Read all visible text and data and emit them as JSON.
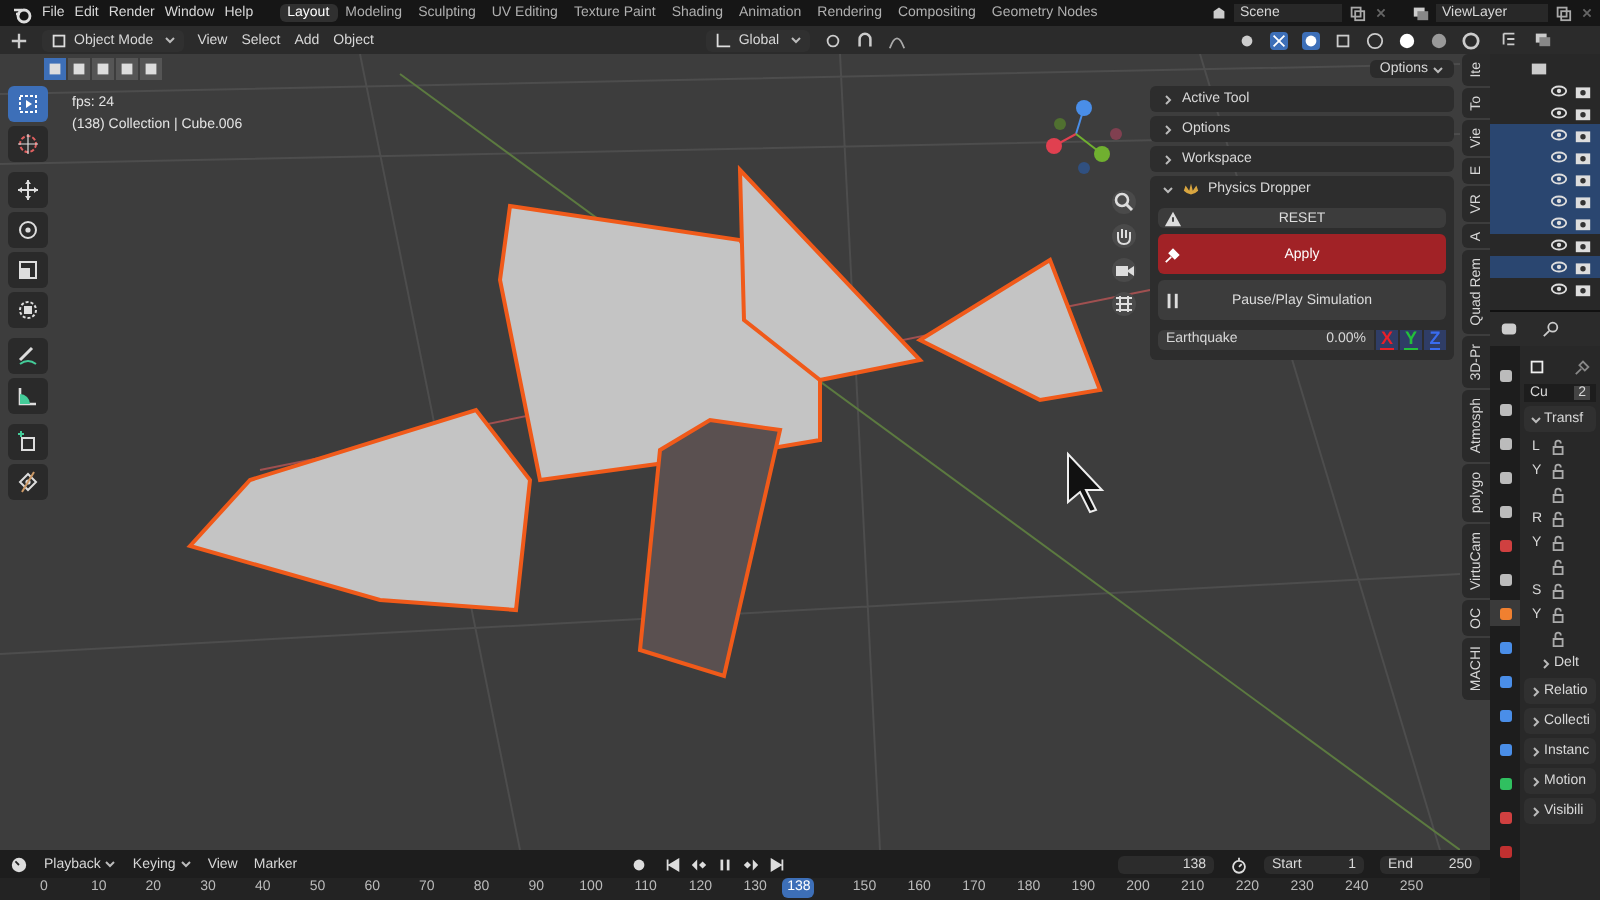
{
  "app_menu": [
    "File",
    "Edit",
    "Render",
    "Window",
    "Help"
  ],
  "workspaces": [
    {
      "label": "Layout",
      "selected": true
    },
    {
      "label": "Modeling",
      "selected": false
    },
    {
      "label": "Sculpting",
      "selected": false
    },
    {
      "label": "UV Editing",
      "selected": false
    },
    {
      "label": "Texture Paint",
      "selected": false
    },
    {
      "label": "Shading",
      "selected": false
    },
    {
      "label": "Animation",
      "selected": false
    },
    {
      "label": "Rendering",
      "selected": false
    },
    {
      "label": "Compositing",
      "selected": false
    },
    {
      "label": "Geometry Nodes",
      "selected": false
    }
  ],
  "scene": "Scene",
  "view_layer": "ViewLayer",
  "viewport_header": {
    "mode": "Object Mode",
    "menus": [
      "View",
      "Select",
      "Add",
      "Object"
    ],
    "orientation": "Global",
    "options": "Options"
  },
  "toolbar": [
    {
      "selected": true
    },
    {
      "selected": false
    },
    {
      "selected": false
    },
    {
      "selected": false
    },
    {
      "selected": false
    },
    {
      "selected": false
    },
    {
      "selected": false
    },
    {
      "selected": false
    },
    {
      "selected": false
    },
    {
      "selected": false
    }
  ],
  "overlay_text": [
    "fps: 24",
    "(138) Collection | Cube.006"
  ],
  "n_panel": {
    "sections": [
      {
        "label": "Active Tool",
        "expanded": false
      },
      {
        "label": "Options",
        "expanded": false
      },
      {
        "label": "Workspace",
        "expanded": false
      },
      {
        "label": "Physics Dropper",
        "expanded": true
      }
    ],
    "reset": "RESET",
    "apply": "Apply",
    "pause": "Pause/Play Simulation",
    "earthquake": {
      "label": "Earthquake",
      "value": "0.00%",
      "level": 0
    },
    "axes": [
      {
        "label": "X",
        "color": "#e8202a"
      },
      {
        "label": "Y",
        "color": "#22c03a"
      },
      {
        "label": "Z",
        "color": "#3a6cf0"
      }
    ]
  },
  "sidebar_tabs": [
    "Ite",
    "To",
    "Vie",
    "E",
    "VR",
    "A",
    "Quad Rem",
    "3D-Pr",
    "Atmosph",
    "polygo",
    "VirtuCam",
    "OC",
    "MACHI"
  ],
  "outliner": [
    {
      "selected": false
    },
    {
      "selected": false
    },
    {
      "selected": true
    },
    {
      "selected": true
    },
    {
      "selected": true
    },
    {
      "selected": true
    },
    {
      "selected": true
    },
    {
      "selected": false
    },
    {
      "selected": true
    },
    {
      "selected": false
    }
  ],
  "properties": {
    "object_name": "Cu",
    "users": "2",
    "tabs": [
      {
        "selected": false
      },
      {
        "selected": false
      },
      {
        "selected": false
      },
      {
        "selected": false
      },
      {
        "selected": false
      },
      {
        "selected": false
      },
      {
        "selected": false
      },
      {
        "selected": true
      },
      {
        "selected": false
      },
      {
        "selected": false
      },
      {
        "selected": false
      },
      {
        "selected": false
      },
      {
        "selected": false
      },
      {
        "selected": false
      },
      {
        "selected": false
      }
    ],
    "transform_title": "Transf",
    "transform_expanded": true,
    "transform_groups": [
      {
        "labels": [
          "L",
          "Y"
        ]
      },
      {
        "labels": [
          "R",
          "Y"
        ]
      },
      {
        "labels": [
          "S",
          "Y"
        ]
      }
    ],
    "delta": "Delt",
    "sections": [
      "Relatio",
      "Collecti",
      "Instanc",
      "Motion",
      "Visibili"
    ]
  },
  "timeline": {
    "menus": [
      "Playback",
      "Keying",
      "View",
      "Marker"
    ],
    "frame": "138",
    "start_label": "Start",
    "start": "1",
    "end_label": "End",
    "end": "250",
    "ruler": [
      "0",
      "10",
      "20",
      "30",
      "40",
      "50",
      "60",
      "70",
      "80",
      "90",
      "100",
      "110",
      "120",
      "130",
      "150",
      "160",
      "170",
      "180",
      "190",
      "200",
      "210",
      "220",
      "230",
      "240",
      "250"
    ],
    "current": "138"
  }
}
